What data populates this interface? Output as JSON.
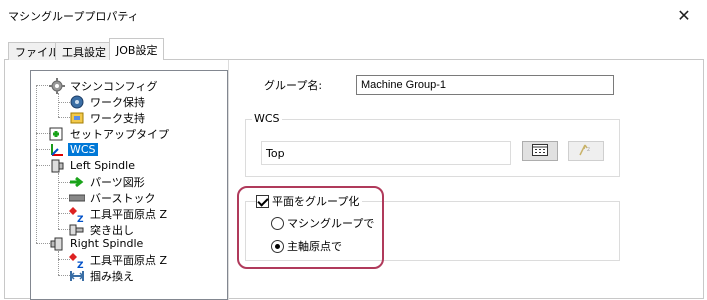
{
  "window": {
    "title": "マシングループプロパティ",
    "close_glyph": "✕"
  },
  "tabs": [
    {
      "label": "ファイル",
      "active": false
    },
    {
      "label": "工具設定",
      "active": false
    },
    {
      "label": "JOB設定",
      "active": true
    }
  ],
  "tree": {
    "items": [
      {
        "label": "マシンコンフィグ",
        "icon": "gear-icon"
      },
      {
        "label": "ワーク保持",
        "icon": "blue-circle-icon"
      },
      {
        "label": "ワーク支持",
        "icon": "support-icon"
      },
      {
        "label": "セットアップタイプ",
        "icon": "setup-icon"
      },
      {
        "label": "WCS",
        "icon": "axes-icon",
        "selected": true
      },
      {
        "label": "Left Spindle",
        "icon": "spindle-icon"
      },
      {
        "label": "パーツ図形",
        "icon": "green-arrow-icon"
      },
      {
        "label": "バーストック",
        "icon": "bar-icon"
      },
      {
        "label": "工具平面原点 Z",
        "icon": "zplane-icon"
      },
      {
        "label": "突き出し",
        "icon": "stick-icon"
      },
      {
        "label": "Right Spindle",
        "icon": "spindle-icon"
      },
      {
        "label": "工具平面原点 Z",
        "icon": "zplane-icon"
      },
      {
        "label": "掴み換え",
        "icon": "transfer-icon"
      }
    ]
  },
  "group": {
    "label": "グループ名:",
    "value": "Machine Group-1"
  },
  "wcs": {
    "legend": "WCS",
    "value": "Top"
  },
  "plane": {
    "checkbox_label": "平面をグループ化",
    "checked": true,
    "options": [
      {
        "label": "マシングループで",
        "selected": false
      },
      {
        "label": "主軸原点で",
        "selected": true
      }
    ]
  },
  "colors": {
    "selection": "#0078d7",
    "highlight": "#b03a5b"
  }
}
